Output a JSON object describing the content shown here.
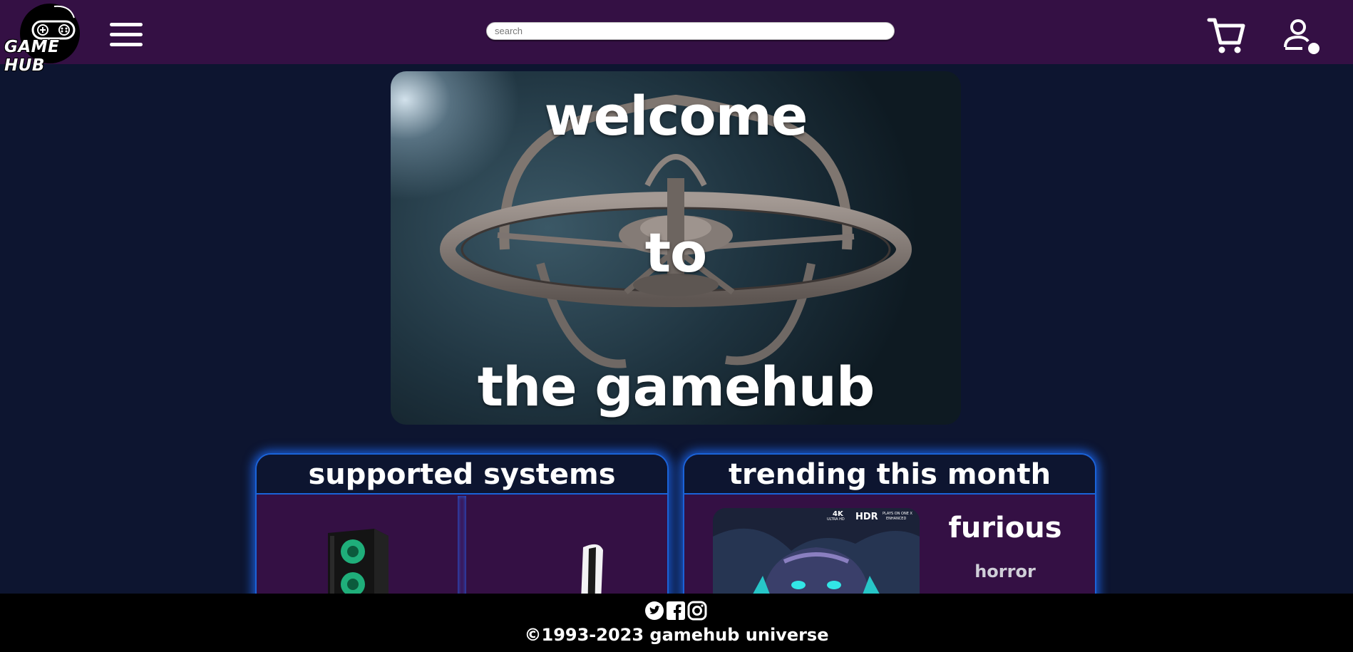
{
  "colors": {
    "header_bg": "#341044",
    "page_bg": "#0d1530",
    "card_bg": "#341044",
    "card_glow": "#1a63d8",
    "footer_bg": "#000000"
  },
  "header": {
    "logo_text": "GAME HUB",
    "menu_icon": "hamburger-menu-icon",
    "search_placeholder": "search",
    "search_value": "",
    "cart_icon": "cart-icon",
    "user_icon": "user-status-icon"
  },
  "hero": {
    "lines": [
      "welcome",
      "to",
      "the gamehub"
    ]
  },
  "supported_systems": {
    "title": "supported systems",
    "systems": [
      {
        "icon": "gaming-pc-icon"
      },
      {
        "icon": "console-icon"
      }
    ]
  },
  "trending": {
    "title": "trending this month",
    "game": {
      "title": "furious",
      "genre": "horror",
      "cover_badges": [
        "4K",
        "ULTRA HD",
        "HDR",
        "PLAYS ON ONE X",
        "ENHANCED"
      ]
    }
  },
  "footer": {
    "socials": [
      "twitter-icon",
      "facebook-icon",
      "instagram-icon"
    ],
    "copyright": "©1993-2023 gamehub universe"
  }
}
